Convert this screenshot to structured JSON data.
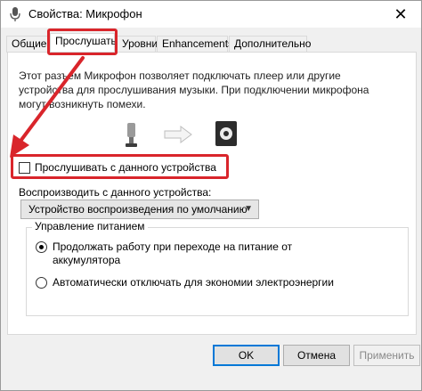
{
  "window": {
    "title": "Свойства: Микрофон",
    "close_glyph": "✕"
  },
  "tabs": [
    {
      "label": "Общие"
    },
    {
      "label": "Прослушать",
      "active": true
    },
    {
      "label": "Уровни"
    },
    {
      "label": "Enhancements"
    },
    {
      "label": "Дополнительно"
    }
  ],
  "listen": {
    "description": "Этот разъем Микрофон позволяет подключать плеер или другие устройства для прослушивания музыки. При подключении микрофона могут возникнуть помехи.",
    "listen_checkbox_label": "Прослушивать с данного устройства",
    "listen_checked": false,
    "playback_label": "Воспроизводить с данного устройства:",
    "playback_device": "Устройство воспроизведения по умолчанию"
  },
  "power": {
    "legend": "Управление питанием",
    "option_continue": "Продолжать работу при переходе на питание от аккумулятора",
    "option_continue_checked": true,
    "option_auto_off": "Автоматически отключать для экономии электроэнергии",
    "option_auto_off_checked": false
  },
  "footer": {
    "ok_label": "OK",
    "cancel_label": "Отмена",
    "apply_label": "Применить"
  },
  "annotation_color": "#d9252b",
  "icons": [
    "microphone-icon",
    "arrow-right-icon",
    "speaker-icon"
  ]
}
